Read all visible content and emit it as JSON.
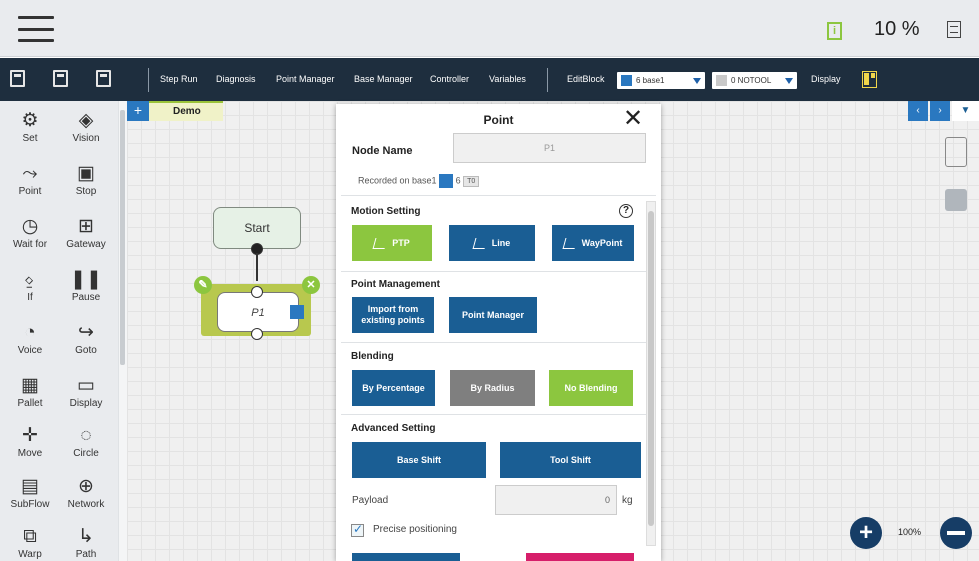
{
  "topbar": {
    "speed_percent": "10 %"
  },
  "toolbar": {
    "items": [
      "Step Run",
      "Diagnosis",
      "Point Manager",
      "Base Manager",
      "Controller",
      "Variables",
      "EditBlock"
    ],
    "base_select": "6 base1",
    "tool_select": "0 NOTOOL",
    "display_label": "Display"
  },
  "sidebar": {
    "items": [
      {
        "label": "Set",
        "icon": "set-icon"
      },
      {
        "label": "Vision",
        "icon": "vision-icon"
      },
      {
        "label": "Point",
        "icon": "point-icon"
      },
      {
        "label": "Stop",
        "icon": "stop-icon"
      },
      {
        "label": "Wait for",
        "icon": "wait-for-icon"
      },
      {
        "label": "Gateway",
        "icon": "gateway-icon"
      },
      {
        "label": "If",
        "icon": "if-icon"
      },
      {
        "label": "Pause",
        "icon": "pause-icon"
      },
      {
        "label": "Voice",
        "icon": "voice-icon"
      },
      {
        "label": "Goto",
        "icon": "goto-icon"
      },
      {
        "label": "Pallet",
        "icon": "pallet-icon"
      },
      {
        "label": "Display",
        "icon": "display-icon"
      },
      {
        "label": "Move",
        "icon": "move-icon"
      },
      {
        "label": "Circle",
        "icon": "circle-icon"
      },
      {
        "label": "SubFlow",
        "icon": "subflow-icon"
      },
      {
        "label": "Network",
        "icon": "network-icon"
      },
      {
        "label": "Warp",
        "icon": "warp-icon"
      },
      {
        "label": "Path",
        "icon": "path-icon"
      }
    ]
  },
  "canvas": {
    "tab_plus": "+",
    "tab_name": "Demo",
    "start_label": "Start",
    "point_label": "P1",
    "zoom": "100%"
  },
  "dialog": {
    "title": "Point",
    "node_name_label": "Node Name",
    "node_name_value": "P1",
    "recorded_on": "Recorded on base1",
    "recorded_base_num": "6",
    "recorded_tool": "T0",
    "motion_setting": "Motion Setting",
    "motion_ptp": "PTP",
    "motion_line": "Line",
    "motion_waypoint": "WayPoint",
    "point_management": "Point Management",
    "import_existing": "Import from existing points",
    "point_manager": "Point Manager",
    "blending": "Blending",
    "by_percentage": "By Percentage",
    "by_radius": "By Radius",
    "no_blending": "No Blending",
    "advanced_setting": "Advanced Setting",
    "base_shift": "Base Shift",
    "tool_shift": "Tool Shift",
    "payload_label": "Payload",
    "payload_value": "0",
    "payload_unit": "kg",
    "precise_positioning": "Precise positioning"
  },
  "colors": {
    "accent_blue": "#1a5e94",
    "accent_green": "#8cc63f",
    "toolbar_dark": "#1e2e3e",
    "pink": "#d61e6a"
  }
}
